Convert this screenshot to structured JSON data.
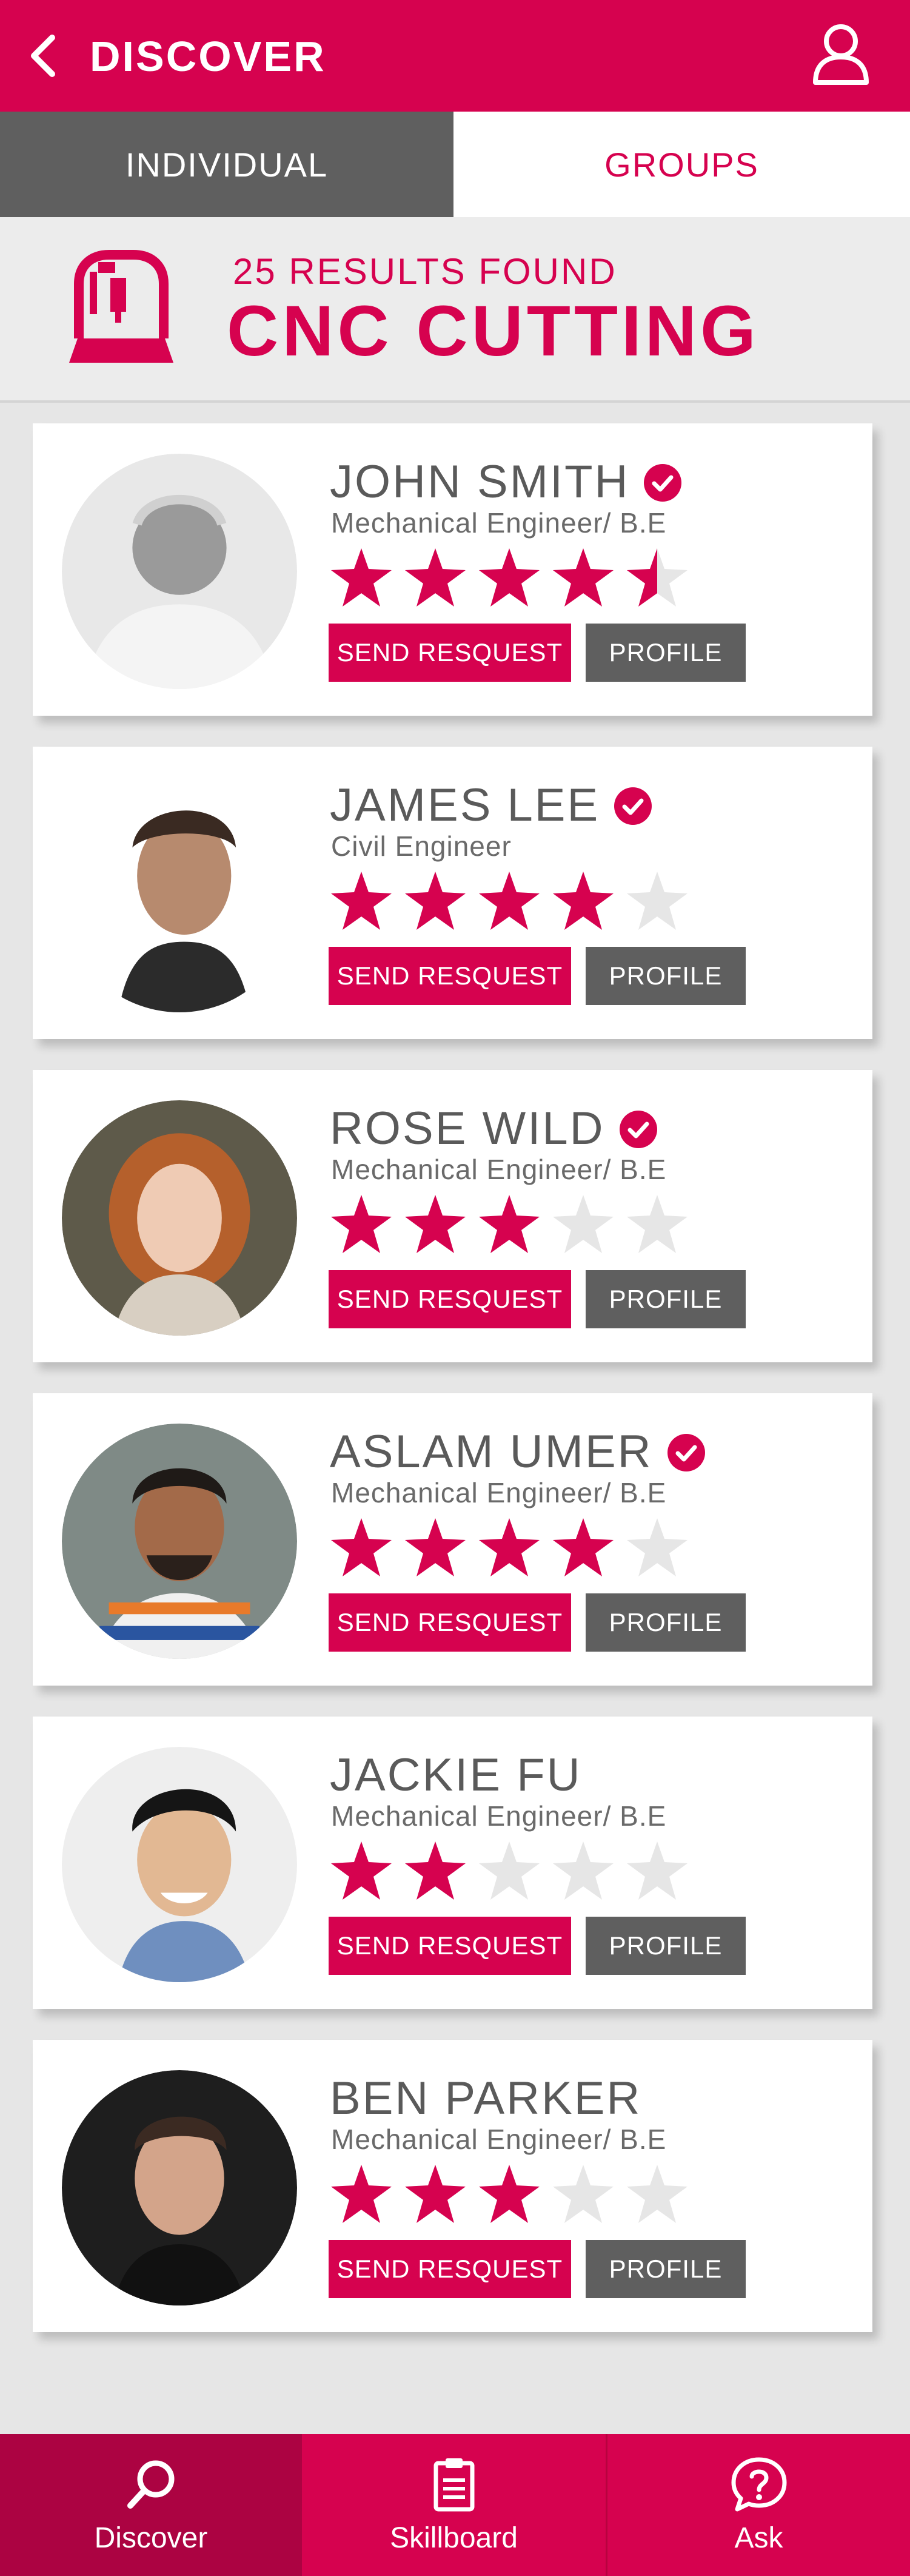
{
  "header": {
    "title": "DISCOVER"
  },
  "tabs": [
    {
      "label": "INDIVIDUAL",
      "active": true
    },
    {
      "label": "GROUPS",
      "active": false
    }
  ],
  "results": {
    "count_text": "25 RESULTS FOUND",
    "category": "CNC CUTTING"
  },
  "buttons": {
    "request_label": "SEND RESQUEST",
    "profile_label": "PROFILE"
  },
  "people": [
    {
      "name": "JOHN SMITH",
      "role": "Mechanical Engineer/ B.E",
      "verified": true,
      "rating": 4.5
    },
    {
      "name": "JAMES LEE",
      "role": "Civil Engineer",
      "verified": true,
      "rating": 4
    },
    {
      "name": "ROSE WILD",
      "role": "Mechanical Engineer/ B.E",
      "verified": true,
      "rating": 3
    },
    {
      "name": "ASLAM UMER",
      "role": "Mechanical Engineer/ B.E",
      "verified": true,
      "rating": 4
    },
    {
      "name": "JACKIE FU",
      "role": "Mechanical Engineer/ B.E",
      "verified": false,
      "rating": 2
    },
    {
      "name": "BEN PARKER",
      "role": "Mechanical Engineer/ B.E",
      "verified": false,
      "rating": 3
    }
  ],
  "bottom_nav": [
    {
      "label": "Discover",
      "icon": "search-icon",
      "active": true
    },
    {
      "label": "Skillboard",
      "icon": "clipboard-icon",
      "active": false
    },
    {
      "label": "Ask",
      "icon": "question-icon",
      "active": false
    }
  ],
  "colors": {
    "accent": "#d6024f",
    "accent_dark": "#ac0342",
    "tab_inactive_bg": "#5f5f5f",
    "star_empty": "#e6e6e6"
  }
}
